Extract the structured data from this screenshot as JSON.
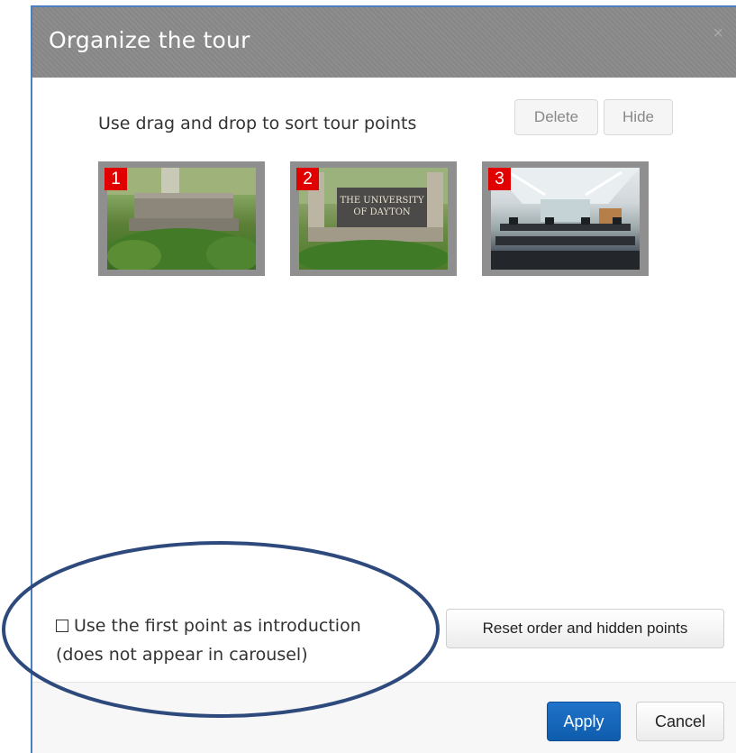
{
  "dialog": {
    "title": "Organize the tour",
    "close_label": "×"
  },
  "instruction": "Use drag and drop to sort tour points",
  "toolbar": {
    "delete_label": "Delete",
    "hide_label": "Hide"
  },
  "tour_points": [
    {
      "number": "1",
      "thumbnail": "stone-sign-photo"
    },
    {
      "number": "2",
      "thumbnail": "university-of-dayton-sign-photo"
    },
    {
      "number": "3",
      "thumbnail": "computer-lab-photo"
    }
  ],
  "options": {
    "intro_checkbox_line1": "Use the first point as introduction",
    "intro_checkbox_line2": "(does not appear in carousel)",
    "intro_checked": false,
    "reset_label": "Reset order and hidden points"
  },
  "footer": {
    "apply_label": "Apply",
    "cancel_label": "Cancel"
  },
  "colors": {
    "header": "#8a8a8a",
    "apply": "#1a6bc0",
    "number_badge": "#e00000",
    "annotation": "#2e4a7d"
  },
  "thumbnail_text": {
    "university_sign_line1": "THE UNIVERSITY",
    "university_sign_line2": "OF DAYTON"
  }
}
